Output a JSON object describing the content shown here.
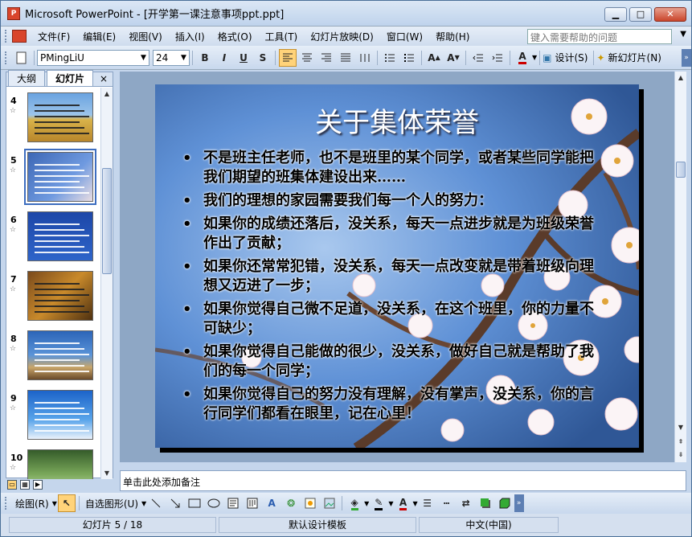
{
  "window": {
    "title": "Microsoft PowerPoint - [开学第一课注意事项ppt.ppt]",
    "app_icon": "P"
  },
  "window_buttons": {
    "minimize": "▁",
    "maximize": "□",
    "close": "✕"
  },
  "menu": {
    "items": [
      "文件(F)",
      "编辑(E)",
      "视图(V)",
      "插入(I)",
      "格式(O)",
      "工具(T)",
      "幻灯片放映(D)",
      "窗口(W)",
      "帮助(H)"
    ],
    "help_placeholder": "键入需要帮助的问题"
  },
  "toolbar": {
    "font_name": "PMingLiU",
    "font_size": "24",
    "bold": "B",
    "italic": "I",
    "underline": "U",
    "shadow": "S",
    "design_label": "设计(S)",
    "new_slide_label": "新幻灯片(N)"
  },
  "panel": {
    "tabs": [
      "大纲",
      "幻灯片"
    ],
    "close": "×",
    "thumbnails": [
      {
        "num": "4",
        "theme": "wheat"
      },
      {
        "num": "5",
        "theme": "blossom",
        "selected": true
      },
      {
        "num": "6",
        "theme": "blue"
      },
      {
        "num": "7",
        "theme": "autumn"
      },
      {
        "num": "8",
        "theme": "sea"
      },
      {
        "num": "9",
        "theme": "flower"
      },
      {
        "num": "10",
        "theme": "forest"
      }
    ]
  },
  "slide": {
    "title": "关于集体荣誉",
    "bullets": [
      "不是班主任老师，也不是班里的某个同学，或者某些同学能把我们期望的班集体建设出来……",
      " 我们的理想的家园需要我们每一个人的努力：",
      " 如果你的成绩还落后，没关系，每天一点进步就是为班级荣誉作出了贡献；",
      "如果你还常常犯错，没关系，每天一点改变就是带着班级向理想又迈进了一步；",
      "如果你觉得自己微不足道，没关系，在这个班里，你的力量不可缺少；",
      "如果你觉得自己能做的很少，没关系，做好自己就是帮助了我们的每一个同学；",
      "如果你觉得自己的努力没有理解，没有掌声，没关系，你的言行同学们都看在眼里，记在心里！"
    ],
    "bullet_char": "•"
  },
  "notes": {
    "placeholder": "单击此处添加备注"
  },
  "drawbar": {
    "draw_label": "绘图(R)",
    "autoshapes_label": "自选图形(U)"
  },
  "status": {
    "slide_pos": "幻灯片 5 / 18",
    "template": "默认设计模板",
    "language": "中文(中国)"
  },
  "colors": {
    "title_bar": "#bfd3ec",
    "accent": "#ffd37a",
    "slide_sky": "#5b8fd4"
  }
}
